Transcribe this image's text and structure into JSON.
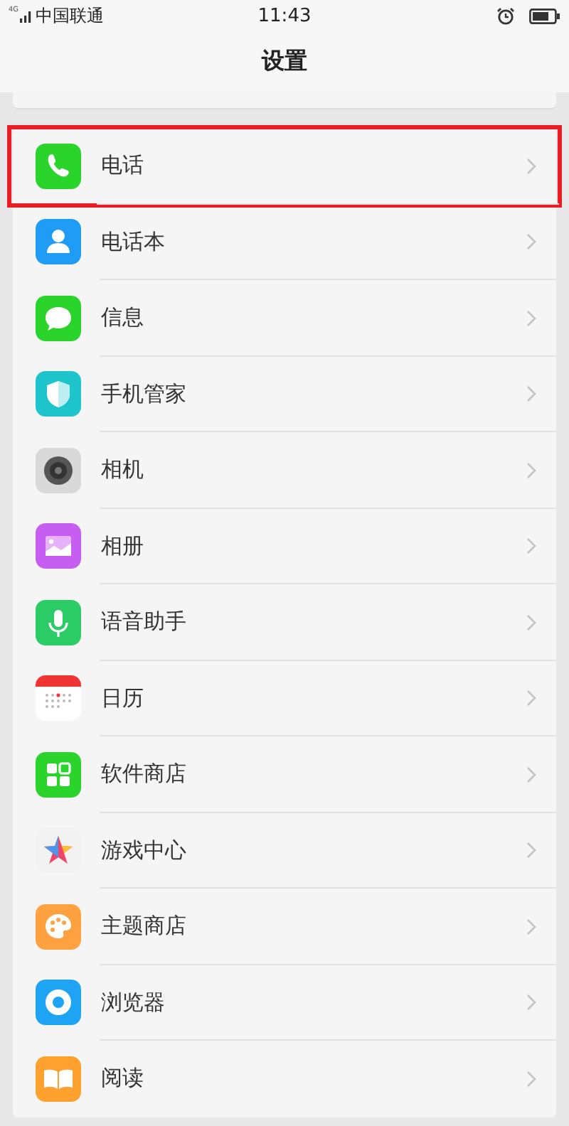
{
  "status_bar": {
    "network": "4G",
    "carrier": "中国联通",
    "time": "11:43"
  },
  "title": "设置",
  "items": [
    {
      "label": "电话",
      "kind": "phone",
      "highlighted": true
    },
    {
      "label": "电话本",
      "kind": "contacts",
      "highlighted": false
    },
    {
      "label": "信息",
      "kind": "message",
      "highlighted": false
    },
    {
      "label": "手机管家",
      "kind": "shield",
      "highlighted": false
    },
    {
      "label": "相机",
      "kind": "camera",
      "highlighted": false
    },
    {
      "label": "相册",
      "kind": "album",
      "highlighted": false
    },
    {
      "label": "语音助手",
      "kind": "mic",
      "highlighted": false
    },
    {
      "label": "日历",
      "kind": "calendar",
      "highlighted": false
    },
    {
      "label": "软件商店",
      "kind": "store",
      "highlighted": false
    },
    {
      "label": "游戏中心",
      "kind": "game",
      "highlighted": false
    },
    {
      "label": "主题商店",
      "kind": "palette",
      "highlighted": false
    },
    {
      "label": "浏览器",
      "kind": "browser",
      "highlighted": false
    },
    {
      "label": "阅读",
      "kind": "book",
      "highlighted": false
    }
  ]
}
